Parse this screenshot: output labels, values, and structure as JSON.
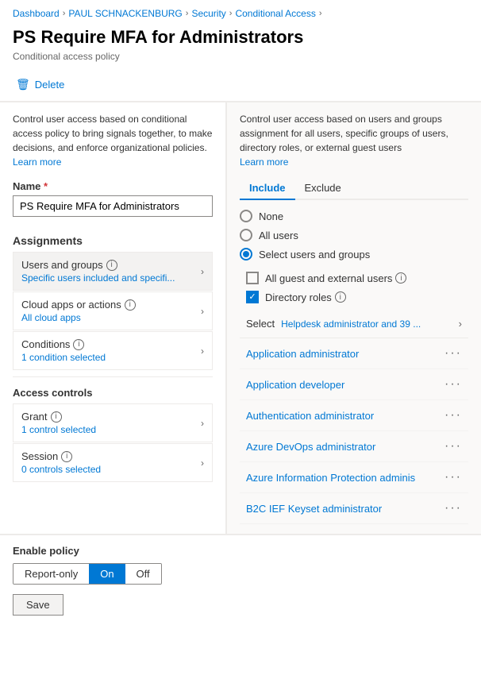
{
  "breadcrumb": {
    "items": [
      {
        "label": "Dashboard"
      },
      {
        "label": "PAUL SCHNACKENBURG"
      },
      {
        "label": "Security"
      },
      {
        "label": "Conditional Access"
      }
    ],
    "separators": [
      ">",
      ">",
      ">",
      ">"
    ]
  },
  "page": {
    "title": "PS Require MFA for Administrators",
    "subtitle": "Conditional access policy"
  },
  "toolbar": {
    "delete_label": "Delete"
  },
  "left_panel": {
    "description": "Control user access based on conditional access policy to bring signals together, to make decisions, and enforce organizational policies.",
    "learn_more_1": "Learn more",
    "name_label": "Name",
    "name_value": "PS Require MFA for Administrators",
    "assignments_label": "Assignments",
    "nav_items": [
      {
        "title": "Users and groups",
        "subtitle": "Specific users included and specifi...",
        "has_info": true
      },
      {
        "title": "Cloud apps or actions",
        "subtitle": "All cloud apps",
        "has_info": true
      },
      {
        "title": "Conditions",
        "subtitle": "1 condition selected",
        "has_info": true
      }
    ],
    "access_controls_label": "Access controls",
    "access_items": [
      {
        "title": "Grant",
        "subtitle": "1 control selected",
        "has_info": true
      },
      {
        "title": "Session",
        "subtitle": "0 controls selected",
        "has_info": true
      }
    ]
  },
  "right_panel": {
    "description": "Control user access based on users and groups assignment for all users, specific groups of users, directory roles, or external guest users",
    "learn_more": "Learn more",
    "tabs": [
      "Include",
      "Exclude"
    ],
    "active_tab": "Include",
    "radio_options": [
      "None",
      "All users",
      "Select users and groups"
    ],
    "selected_radio": "Select users and groups",
    "checkboxes": [
      {
        "label": "All guest and external users",
        "checked": false,
        "has_info": true
      },
      {
        "label": "Directory roles",
        "checked": true,
        "has_info": true
      }
    ],
    "select_label": "Select",
    "select_value": "Helpdesk administrator and 39 ...",
    "roles": [
      {
        "name": "Application administrator"
      },
      {
        "name": "Application developer"
      },
      {
        "name": "Authentication administrator"
      },
      {
        "name": "Azure DevOps administrator"
      },
      {
        "name": "Azure Information Protection adminis"
      },
      {
        "name": "B2C IEF Keyset administrator"
      }
    ]
  },
  "bottom": {
    "enable_label": "Enable policy",
    "toggle_options": [
      "Report-only",
      "On",
      "Off"
    ],
    "active_toggle": "On",
    "save_label": "Save"
  }
}
